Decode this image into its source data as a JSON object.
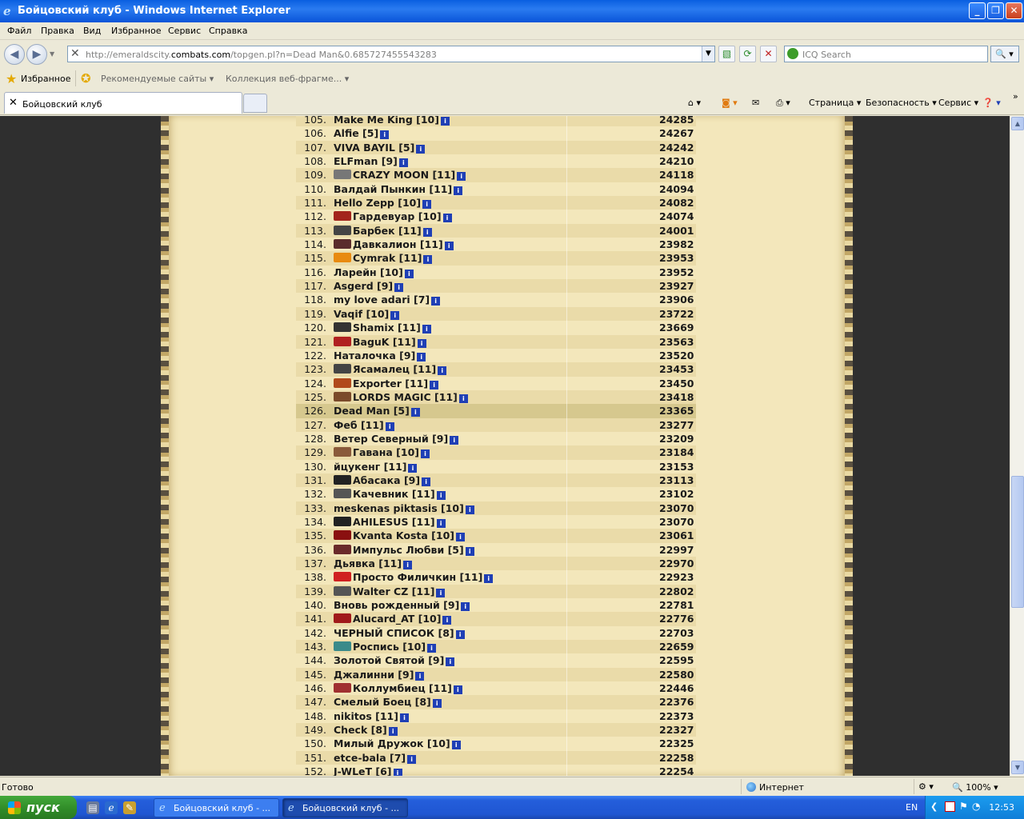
{
  "window": {
    "title": "Бойцовский клуб - Windows Internet Explorer",
    "controls": [
      "_",
      "❐",
      "✕"
    ]
  },
  "menu": [
    "Файл",
    "Правка",
    "Вид",
    "Избранное",
    "Сервис",
    "Справка"
  ],
  "address": {
    "url_prefix": "http://emeraldscity.",
    "url_host": "combats.com",
    "url_rest": "/topgen.pl?n=Dead Man&0.685727455543283"
  },
  "search": {
    "placeholder": "ICQ Search"
  },
  "favorites": {
    "label": "Избранное",
    "suggested": "Рекомендуемые сайты",
    "collection": "Коллекция веб-фрагме..."
  },
  "tab": {
    "title": "Бойцовский клуб"
  },
  "commands": [
    "Страница",
    "Безопасность",
    "Сервис"
  ],
  "ranking": [
    {
      "n": "105.",
      "name": "Make Me King [10]",
      "score": "24285",
      "clan": ""
    },
    {
      "n": "106.",
      "name": "Alfie [5]",
      "score": "24267",
      "clan": ""
    },
    {
      "n": "107.",
      "name": "VIVA BAYIL [5]",
      "score": "24242",
      "clan": ""
    },
    {
      "n": "108.",
      "name": "ELFman [9]",
      "score": "24210",
      "clan": ""
    },
    {
      "n": "109.",
      "name": "CRAZY MOON [11]",
      "score": "24118",
      "clan": "#777"
    },
    {
      "n": "110.",
      "name": "Валдай Пынкин [11]",
      "score": "24094",
      "clan": ""
    },
    {
      "n": "111.",
      "name": "Hello Zepp [10]",
      "score": "24082",
      "clan": ""
    },
    {
      "n": "112.",
      "name": "Гардевуар [10]",
      "score": "24074",
      "clan": "#a3241c"
    },
    {
      "n": "113.",
      "name": "Барбек [11]",
      "score": "24001",
      "clan": "#444"
    },
    {
      "n": "114.",
      "name": "Давкалион [11]",
      "score": "23982",
      "clan": "#5a2c2c"
    },
    {
      "n": "115.",
      "name": "Cymrak [11]",
      "score": "23953",
      "clan": "#e88a10"
    },
    {
      "n": "116.",
      "name": "Ларейн [10]",
      "score": "23952",
      "clan": ""
    },
    {
      "n": "117.",
      "name": "Asgerd [9]",
      "score": "23927",
      "clan": ""
    },
    {
      "n": "118.",
      "name": "my love adari [7]",
      "score": "23906",
      "clan": ""
    },
    {
      "n": "119.",
      "name": "Vaqif [10]",
      "score": "23722",
      "clan": ""
    },
    {
      "n": "120.",
      "name": "Shamix [11]",
      "score": "23669",
      "clan": "#333"
    },
    {
      "n": "121.",
      "name": "BaguK [11]",
      "score": "23563",
      "clan": "#b02020"
    },
    {
      "n": "122.",
      "name": "Наталочка [9]",
      "score": "23520",
      "clan": ""
    },
    {
      "n": "123.",
      "name": "Ясамалец [11]",
      "score": "23453",
      "clan": "#444"
    },
    {
      "n": "124.",
      "name": "Exporter [11]",
      "score": "23450",
      "clan": "#b14a1c"
    },
    {
      "n": "125.",
      "name": "LORDS MAGIC [11]",
      "score": "23418",
      "clan": "#7a4a2a"
    },
    {
      "n": "126.",
      "name": "Dead Man [5]",
      "score": "23365",
      "clan": ""
    },
    {
      "n": "127.",
      "name": "Феб [11]",
      "score": "23277",
      "clan": ""
    },
    {
      "n": "128.",
      "name": "Ветер Северный [9]",
      "score": "23209",
      "clan": ""
    },
    {
      "n": "129.",
      "name": "Гавана [10]",
      "score": "23184",
      "clan": "#8a5a3a"
    },
    {
      "n": "130.",
      "name": "йцукенг [11]",
      "score": "23153",
      "clan": ""
    },
    {
      "n": "131.",
      "name": "Абасака [9]",
      "score": "23113",
      "clan": "#222"
    },
    {
      "n": "132.",
      "name": "Качевник [11]",
      "score": "23102",
      "clan": "#555"
    },
    {
      "n": "133.",
      "name": "meskenas piktasis [10]",
      "score": "23070",
      "clan": ""
    },
    {
      "n": "134.",
      "name": "AHILESUS [11]",
      "score": "23070",
      "clan": "#222"
    },
    {
      "n": "135.",
      "name": "Kvanta Kosta [10]",
      "score": "23061",
      "clan": "#8a1010"
    },
    {
      "n": "136.",
      "name": "Импульс Любви [5]",
      "score": "22997",
      "clan": "#6a2a2a"
    },
    {
      "n": "137.",
      "name": "Дьявка [11]",
      "score": "22970",
      "clan": ""
    },
    {
      "n": "138.",
      "name": "Просто Филичкин [11]",
      "score": "22923",
      "clan": "#d02020"
    },
    {
      "n": "139.",
      "name": "Walter CZ [11]",
      "score": "22802",
      "clan": "#555"
    },
    {
      "n": "140.",
      "name": "Вновь рожденный [9]",
      "score": "22781",
      "clan": ""
    },
    {
      "n": "141.",
      "name": "Alucard_AT [10]",
      "score": "22776",
      "clan": "#a01a1a"
    },
    {
      "n": "142.",
      "name": "ЧЕРНЫЙ СПИСОК [8]",
      "score": "22703",
      "clan": ""
    },
    {
      "n": "143.",
      "name": "Роспись [10]",
      "score": "22659",
      "clan": "#3a8a8a"
    },
    {
      "n": "144.",
      "name": "Золотой Святой [9]",
      "score": "22595",
      "clan": ""
    },
    {
      "n": "145.",
      "name": "Джалинни [9]",
      "score": "22580",
      "clan": ""
    },
    {
      "n": "146.",
      "name": "Коллумбиец [11]",
      "score": "22446",
      "clan": "#a03030"
    },
    {
      "n": "147.",
      "name": "Смелый Боец [8]",
      "score": "22376",
      "clan": ""
    },
    {
      "n": "148.",
      "name": "nikitos [11]",
      "score": "22373",
      "clan": ""
    },
    {
      "n": "149.",
      "name": "Check [8]",
      "score": "22327",
      "clan": ""
    },
    {
      "n": "150.",
      "name": "Милый Дружок [10]",
      "score": "22325",
      "clan": ""
    },
    {
      "n": "151.",
      "name": "etce-bala [7]",
      "score": "22258",
      "clan": ""
    },
    {
      "n": "152.",
      "name": "J-WLeT [6]",
      "score": "22254",
      "clan": ""
    }
  ],
  "current_row": "126.",
  "status": {
    "text": "Готово",
    "zone": "Интернет",
    "zoom": "100%"
  },
  "taskbar": {
    "start": "пуск",
    "tasks": [
      "Бойцовский клуб - ...",
      "Бойцовский клуб - ..."
    ],
    "lang": "EN",
    "time": "12:53"
  }
}
